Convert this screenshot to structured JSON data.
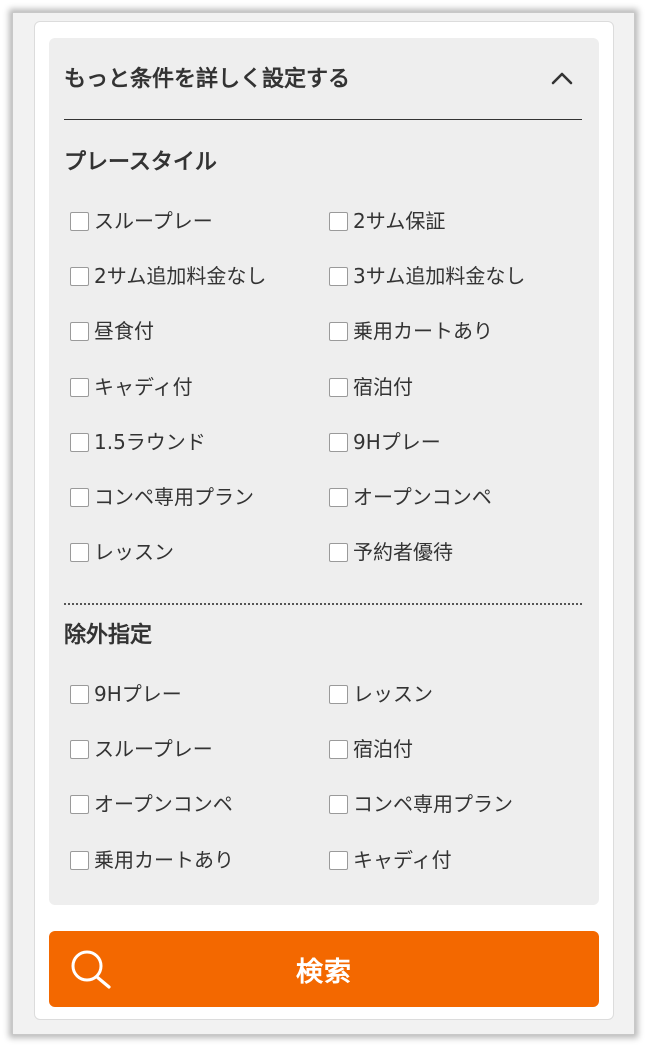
{
  "panel": {
    "title": "もっと条件を詳しく設定する",
    "toggle_icon": "chevron-up-icon"
  },
  "play_style": {
    "title": "プレースタイル",
    "options": [
      {
        "label": "スループレー",
        "checked": false
      },
      {
        "label": "2サム保証",
        "checked": false
      },
      {
        "label": "2サム追加料金なし",
        "checked": false
      },
      {
        "label": "3サム追加料金なし",
        "checked": false
      },
      {
        "label": "昼食付",
        "checked": false
      },
      {
        "label": "乗用カートあり",
        "checked": false
      },
      {
        "label": "キャディ付",
        "checked": false
      },
      {
        "label": "宿泊付",
        "checked": false
      },
      {
        "label": "1.5ラウンド",
        "checked": false
      },
      {
        "label": "9Hプレー",
        "checked": false
      },
      {
        "label": "コンペ専用プラン",
        "checked": false
      },
      {
        "label": "オープンコンペ",
        "checked": false
      },
      {
        "label": "レッスン",
        "checked": false
      },
      {
        "label": "予約者優待",
        "checked": false
      }
    ]
  },
  "exclude": {
    "title": "除外指定",
    "options": [
      {
        "label": "9Hプレー",
        "checked": false
      },
      {
        "label": "レッスン",
        "checked": false
      },
      {
        "label": "スループレー",
        "checked": false
      },
      {
        "label": "宿泊付",
        "checked": false
      },
      {
        "label": "オープンコンペ",
        "checked": false
      },
      {
        "label": "コンペ専用プラン",
        "checked": false
      },
      {
        "label": "乗用カートあり",
        "checked": false
      },
      {
        "label": "キャディ付",
        "checked": false
      }
    ]
  },
  "search": {
    "label": "検索",
    "icon": "search-icon"
  },
  "colors": {
    "accent": "#f36800",
    "panel_bg": "#eeeeee",
    "text": "#333333"
  }
}
